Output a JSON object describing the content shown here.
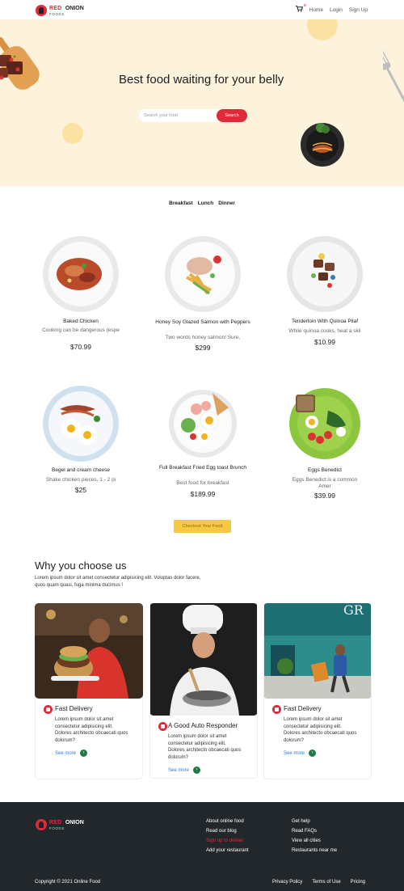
{
  "nav": {
    "brand_red": "RED",
    "brand_dark": "ONION",
    "brand_sub": "FOODS",
    "cart_count": "0",
    "links": [
      "Home",
      "Login",
      "Sign Up"
    ]
  },
  "hero": {
    "title": "Best food waiting for your belly",
    "search_placeholder": "Search your food",
    "search_button": "Search"
  },
  "menu_tabs": [
    "Breakfast",
    "Lunch",
    "Dinner"
  ],
  "foods": [
    {
      "name": "Baked Chicken",
      "desc": "Cooking can be dangerous (espe",
      "price": "$70.99"
    },
    {
      "name": "Honey Soy Glazed Salmon with Peppers",
      "desc": "Two words honey salmon! Sure,",
      "price": "$299"
    },
    {
      "name": "Tenderloin With Quinoa Pilaf",
      "desc": "While quinoa cooks, heat a skil",
      "price": "$10.99"
    },
    {
      "name": "Begel and cream cheese",
      "desc": "Shake chicken pieces, 1 - 2 pi",
      "price": "$25"
    },
    {
      "name": "Full Breakfast Fried Egg toast Brunch",
      "desc": "Best food for breakfast",
      "price": "$189.99"
    },
    {
      "name": "Eggs Benedict",
      "desc": "Eggs Benedict is a common Amer",
      "price": "$39.99"
    }
  ],
  "checkout_button": "Checkout Your Food",
  "why": {
    "title": "Why you choose us",
    "text": "Lorem ipsum dolor sit amet consectetur adipisicing elit. Voluptas dolor facere, quos quam quasi, fuga minima ducimus !",
    "cards": [
      {
        "title": "Fast Delivery",
        "text": "Lorem ipsum dolor sit amet consectetur adipisicing elit. Dolores architecto obcaecati quos dolorum?",
        "link": "See more"
      },
      {
        "title": "A Good Auto Responder",
        "text": "Lorem ipsum dolor sit amet consectetur adipisicing elit. Dolores architecto obcaecati quos dolorum?",
        "link": "See more"
      },
      {
        "title": "Fast Delivery",
        "text": "Lorem ipsum dolor sit amet consectetur adipisicing elit. Dolores architecto obcaecati quos dolorum?",
        "link": "See more"
      }
    ]
  },
  "footer": {
    "brand_red": "RED",
    "brand_dark": "ONION",
    "brand_sub": "FOODS",
    "col1": [
      "About online food",
      "Read our blog",
      "Sign up to deliver",
      "Add your restaurant"
    ],
    "col2": [
      "Get help",
      "Read FAQs",
      "View all cities",
      "Restaurants near me"
    ],
    "copyright": "Copyright © 2021 Online Food",
    "bottom_links": [
      "Privacy Policy",
      "Terms of Use",
      "Pricing"
    ]
  },
  "colors": {
    "accent": "#e12a39",
    "hero_bg": "#fdf2dc",
    "checkout": "#f7c841",
    "footer_bg": "#22272c",
    "link": "#2f7ad8"
  }
}
